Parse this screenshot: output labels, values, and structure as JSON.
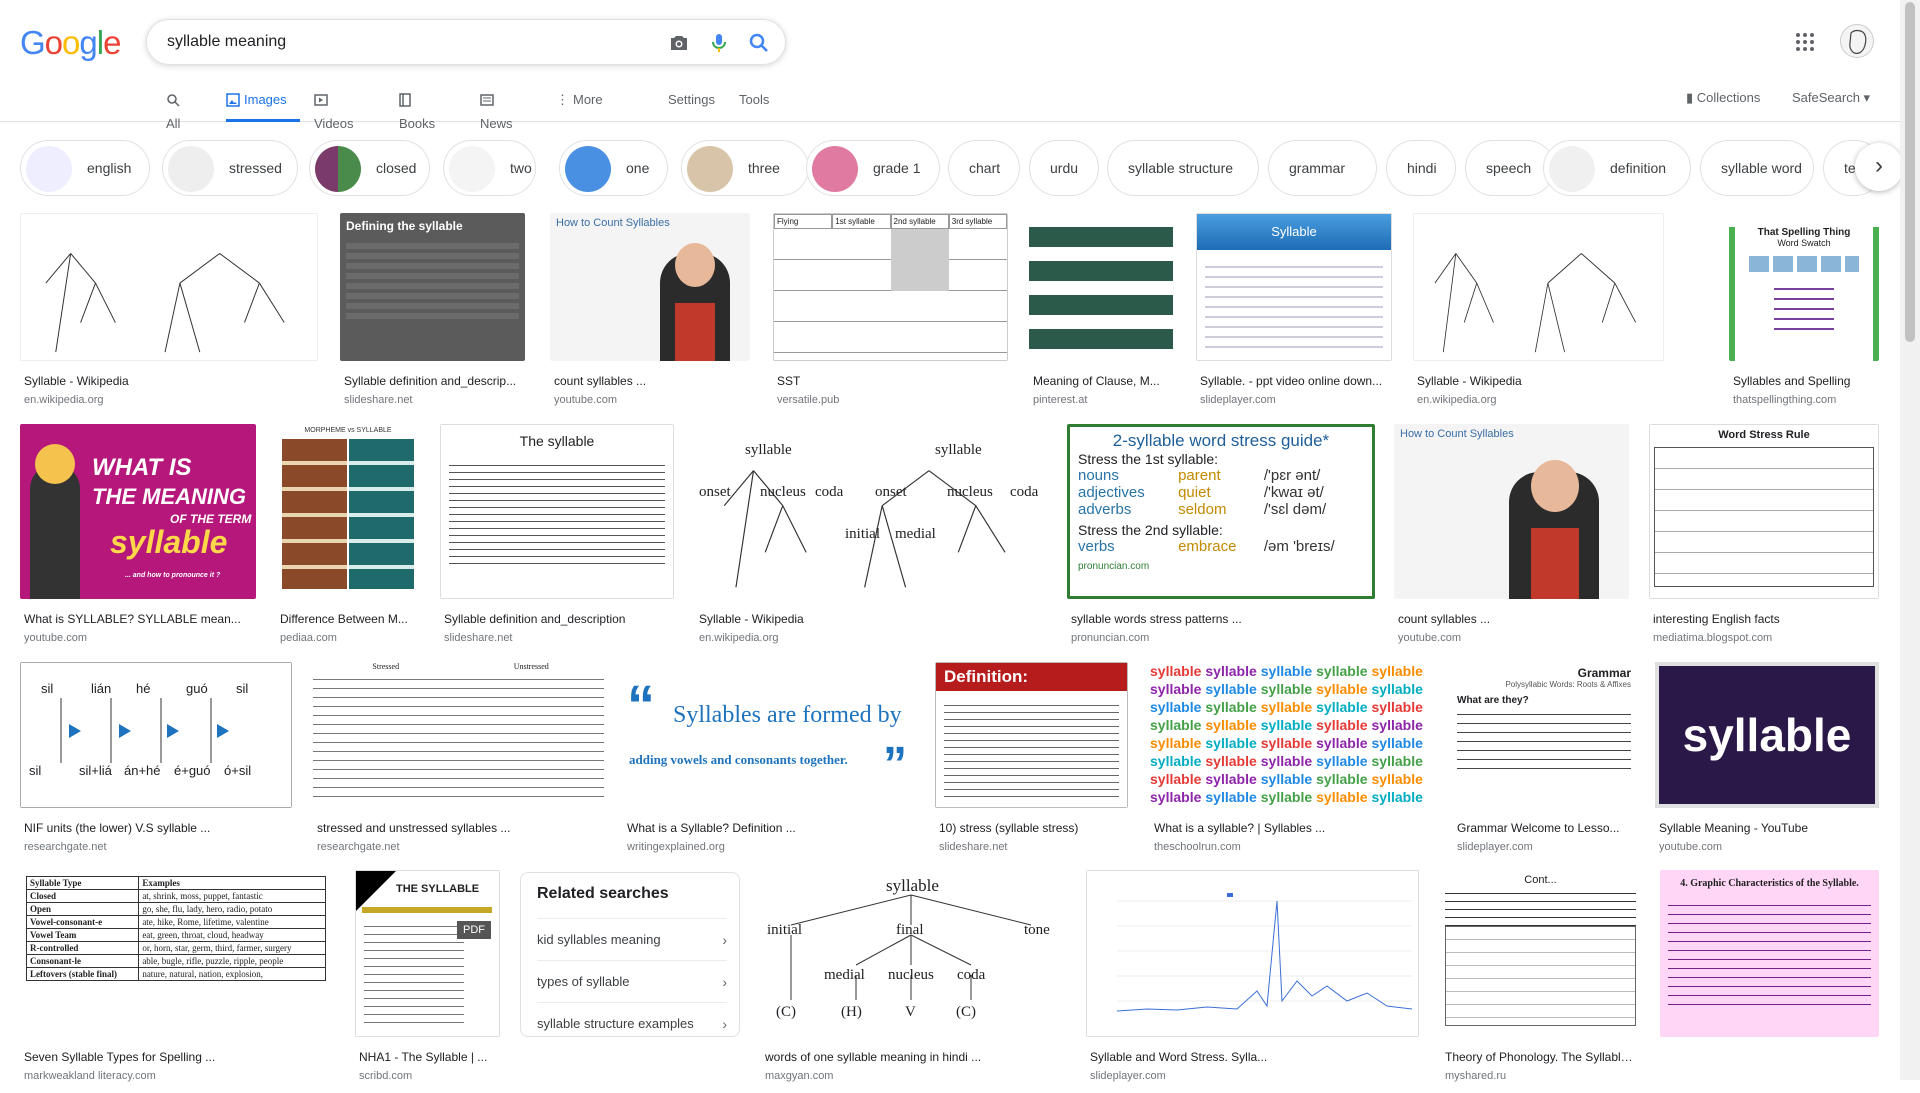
{
  "search": {
    "query": "syllable meaning"
  },
  "logo_letters": [
    {
      "ch": "G",
      "color": "#4285f4"
    },
    {
      "ch": "o",
      "color": "#ea4335"
    },
    {
      "ch": "o",
      "color": "#fbbc05"
    },
    {
      "ch": "g",
      "color": "#4285f4"
    },
    {
      "ch": "l",
      "color": "#34a853"
    },
    {
      "ch": "e",
      "color": "#ea4335"
    }
  ],
  "tabs": {
    "all": "All",
    "images": "Images",
    "videos": "Videos",
    "books": "Books",
    "news": "News",
    "more": "More",
    "settings": "Settings",
    "tools": "Tools"
  },
  "header": {
    "collections": "Collections",
    "safesearch": "SafeSearch"
  },
  "chips": [
    "english",
    "stressed",
    "closed",
    "two",
    "one",
    "three",
    "grade 1",
    "chart",
    "urdu",
    "syllable structure",
    "grammar",
    "hindi",
    "speech",
    "definition",
    "syllable word",
    "tea"
  ],
  "results": [
    {
      "title": "Syllable - Wikipedia",
      "source": "en.wikipedia.org"
    },
    {
      "title": "Syllable definition and_descrip...",
      "source": "slideshare.net"
    },
    {
      "title": "count syllables ...",
      "source": "youtube.com"
    },
    {
      "title": "SST",
      "source": "versatile.pub"
    },
    {
      "title": "Meaning of Clause, M...",
      "source": "pinterest.at"
    },
    {
      "title": "Syllable. - ppt video online down...",
      "source": "slideplayer.com"
    },
    {
      "title": "Syllable - Wikipedia",
      "source": "en.wikipedia.org"
    },
    {
      "title": "Syllables and Spelling",
      "source": "thatspellingthing.com"
    },
    {
      "title": "What is SYLLABLE? SYLLABLE mean...",
      "source": "youtube.com"
    },
    {
      "title": "Difference Between M...",
      "source": "pediaa.com"
    },
    {
      "title": "Syllable definition and_description",
      "source": "slideshare.net"
    },
    {
      "title": "Syllable - Wikipedia",
      "source": "en.wikipedia.org"
    },
    {
      "title": "syllable words stress patterns ...",
      "source": "pronuncian.com"
    },
    {
      "title": "count syllables ...",
      "source": "youtube.com"
    },
    {
      "title": "interesting English facts",
      "source": "mediatima.blogspot.com"
    },
    {
      "title": "NIF units (the lower) V.S syllable ...",
      "source": "researchgate.net"
    },
    {
      "title": "stressed and unstressed syllables ...",
      "source": "researchgate.net"
    },
    {
      "title": "What is a Syllable? Definition ...",
      "source": "writingexplained.org"
    },
    {
      "title": "10) stress (syllable stress)",
      "source": "slideshare.net"
    },
    {
      "title": "What is a syllable? | Syllables ...",
      "source": "theschoolrun.com"
    },
    {
      "title": "Grammar Welcome to Lesso...",
      "source": "slideplayer.com"
    },
    {
      "title": "Syllable Meaning - YouTube",
      "source": "youtube.com"
    },
    {
      "title": "Seven Syllable Types for Spelling ...",
      "source": "markweakland literacy.com"
    },
    {
      "title": "NHA1 - The Syllable | ...",
      "source": "scribd.com"
    },
    {
      "title": "Syllable - Wikipedia",
      "source": "en.wikipedia.org"
    },
    {
      "title": "words of one syllable meaning in hindi ...",
      "source": "maxgyan.com"
    },
    {
      "title": "Syllable and Word Stress. Sylla...",
      "source": "slideplayer.com"
    },
    {
      "title": "Theory of Phonology. The Syllable ...",
      "source": "myshared.ru"
    }
  ],
  "thumb_text": {
    "defining": "Defining the syllable",
    "count_title": "How to Count Syllables",
    "sst_head": [
      "Flying",
      "1st syllable",
      "2nd syllable",
      "3rd syllable"
    ],
    "ppt_title": "Syllable",
    "spelling_title": "That Spelling Thing",
    "spelling_sub": "Word Swatch",
    "whatis_1": "WHAT IS",
    "whatis_2": "THE MEANING",
    "whatis_3": "OF THE TERM",
    "whatis_4": "syllable",
    "whatis_5": "... and how to pronounce it ?",
    "morpheme": "MORPHEME vs SYLLABLE",
    "the_syllable": "The syllable",
    "tree_labels": [
      "syllable",
      "onset",
      "nucleus",
      "coda",
      "initial",
      "medial"
    ],
    "stress_guide_title": "2-syllable word stress guide*",
    "stress_1st": "Stress the 1st syllable:",
    "stress_2nd": "Stress the 2nd syllable:",
    "stress_rows": [
      [
        "nouns",
        "parent",
        "/'pɛr ənt/"
      ],
      [
        "adjectives",
        "quiet",
        "/'kwaɪ ət/"
      ],
      [
        "adverbs",
        "seldom",
        "/'sɛl dəm/"
      ]
    ],
    "stress_rows2": [
      [
        "verbs",
        "embrace",
        "/əm 'breɪs/"
      ]
    ],
    "pronuncian": "pronuncian.com",
    "word_stress_rule": "Word Stress Rule",
    "nif_top": [
      "sil",
      "lián",
      "hé",
      "guó",
      "sil"
    ],
    "nif_bottom": [
      "sil",
      "sil+liá",
      "án+hé",
      "é+guó",
      "ó+sil"
    ],
    "stressed": "Stressed",
    "unstressed": "Unstressed",
    "formed_1": "Syllables are formed by",
    "formed_2": "adding vowels and consonants together.",
    "definition": "Definition:",
    "syllable_word": "syllable",
    "grammar_title": "Grammar",
    "grammar_sub": "Polysyllabic Words: Roots & Affixes",
    "grammar_q": "What are they?",
    "syllable_big": "syllable",
    "types_head": [
      "Syllable Type",
      "Examples"
    ],
    "types_rows": [
      [
        "Closed",
        "at, shrink, moss, puppet, fantastic"
      ],
      [
        "Open",
        "go, she, flu, lady, hero, radio, potato"
      ],
      [
        "Vowel-consonant-e",
        "ate, hike, Rome, lifetime, valentine"
      ],
      [
        "Vowel Team",
        "eat, green, throat, cloud, headway"
      ],
      [
        "R-controlled",
        "or, horn, star, germ, third, farmer, surgery"
      ],
      [
        "Consonant-le",
        "able, bugle, rifle, puzzle, ripple, people"
      ],
      [
        "Leftovers (stable final)",
        "nature, natural, nation, explosion,"
      ]
    ],
    "nha_title": "THE SYLLABLE",
    "pdf": "PDF",
    "tree2": [
      "syllable",
      "initial",
      "final",
      "tone",
      "medial",
      "nucleus",
      "coda",
      "(C)",
      "(H)",
      "V",
      "(C)"
    ],
    "cont": "Cont...",
    "graphic": "4. Graphic Characteristics of the Syllable."
  },
  "related": {
    "heading": "Related searches",
    "items": [
      "kid syllables meaning",
      "types of syllable",
      "syllable structure examples"
    ]
  }
}
